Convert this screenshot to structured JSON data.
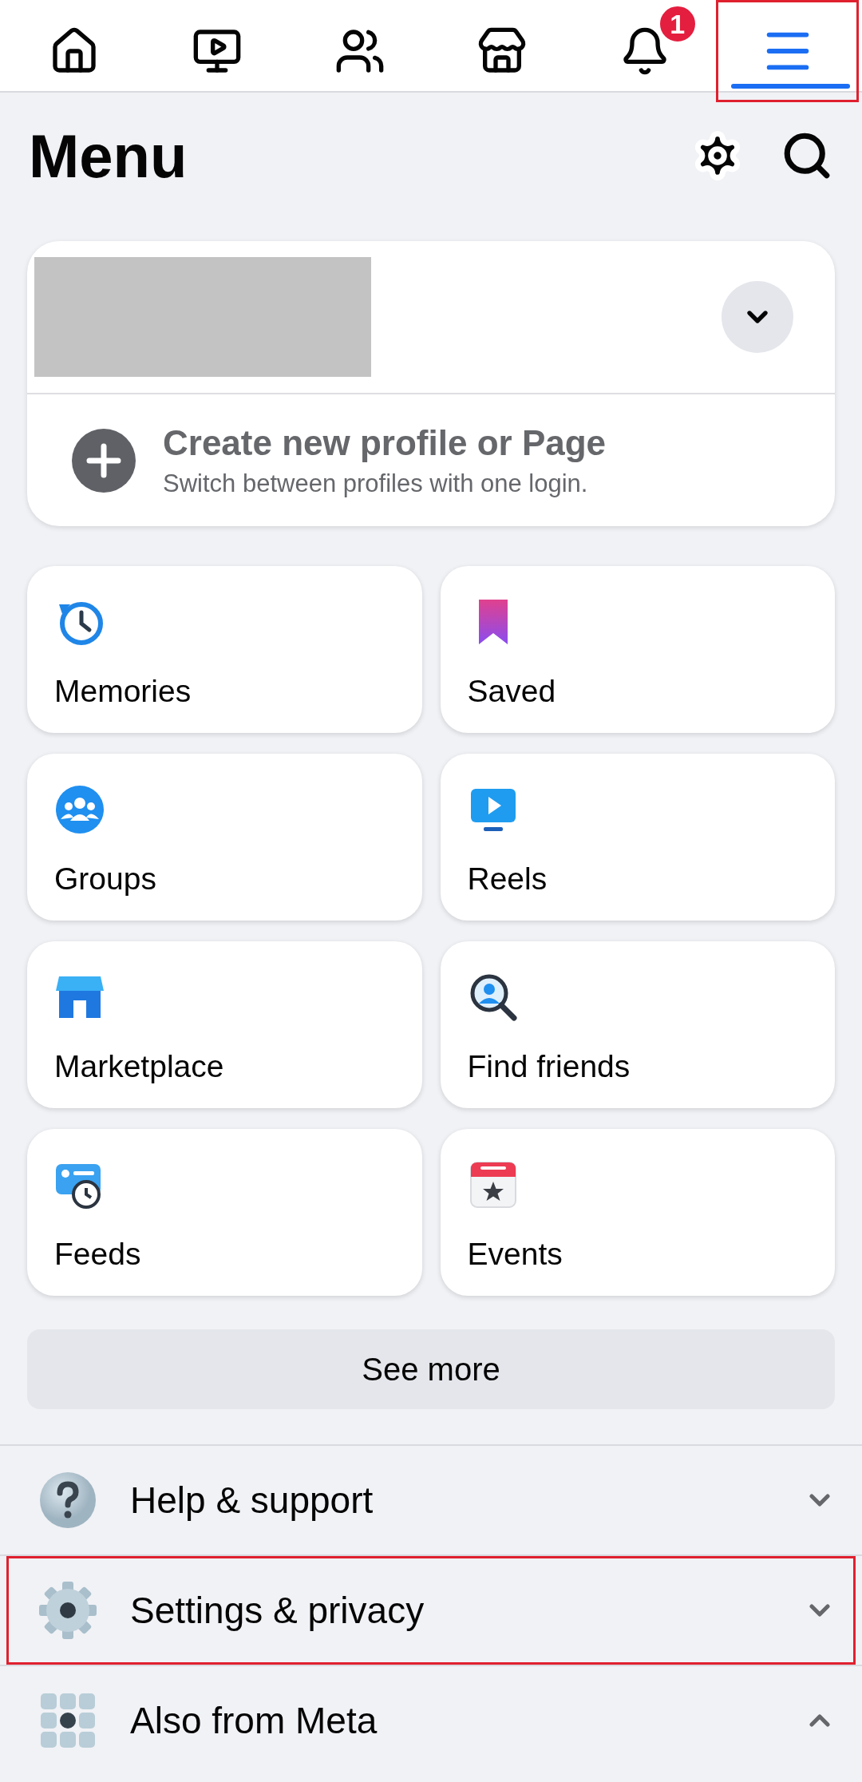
{
  "nav_tabs": [
    {
      "selected": false,
      "highlighted": false
    },
    {
      "selected": false,
      "highlighted": false
    },
    {
      "selected": false,
      "highlighted": false
    },
    {
      "selected": false,
      "highlighted": false
    },
    {
      "selected": false,
      "highlighted": false,
      "badge": "1"
    },
    {
      "selected": true,
      "highlighted": true
    }
  ],
  "title": "Menu",
  "profile_card": {
    "create_title": "Create new profile or Page",
    "create_subtitle": "Switch between profiles with one login."
  },
  "shortcuts": [
    {
      "label": "Memories"
    },
    {
      "label": "Saved"
    },
    {
      "label": "Groups"
    },
    {
      "label": "Reels"
    },
    {
      "label": "Marketplace"
    },
    {
      "label": "Find friends"
    },
    {
      "label": "Feeds"
    },
    {
      "label": "Events"
    }
  ],
  "see_more": "See more",
  "sections": [
    {
      "label": "Help & support",
      "expanded": false,
      "highlighted": false
    },
    {
      "label": "Settings & privacy",
      "expanded": false,
      "highlighted": true
    },
    {
      "label": "Also from Meta",
      "expanded": true,
      "highlighted": false
    }
  ]
}
